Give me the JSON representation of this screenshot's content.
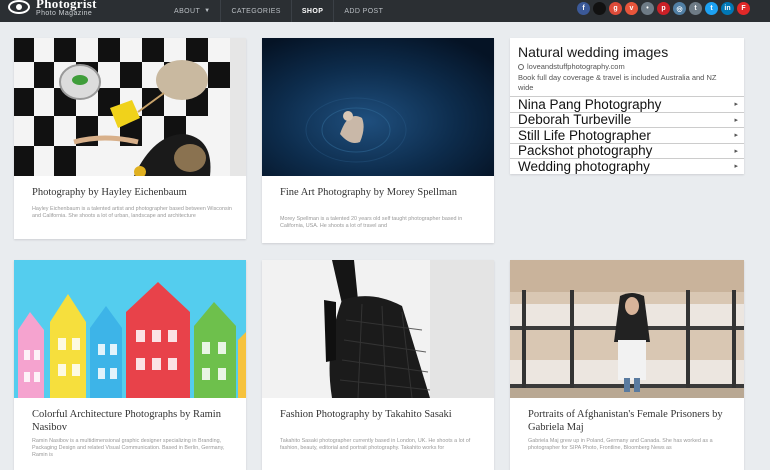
{
  "brand": {
    "title": "Photogrist",
    "subtitle": "Photo Magazine"
  },
  "nav": [
    {
      "label": "ABOUT",
      "dropdown": true
    },
    {
      "label": "CATEGORIES",
      "dropdown": false
    },
    {
      "label": "SHOP",
      "dropdown": false,
      "active": true
    },
    {
      "label": "ADD POST",
      "dropdown": false
    }
  ],
  "social": [
    {
      "icon": "facebook-icon",
      "glyph": "f",
      "color": "#3b5998"
    },
    {
      "icon": "circle-icon",
      "glyph": "",
      "color": "#111111"
    },
    {
      "icon": "google-plus-icon",
      "glyph": "g",
      "color": "#dd4b39"
    },
    {
      "icon": "vine-icon",
      "glyph": "v",
      "color": "#e8553b"
    },
    {
      "icon": "flickr-icon",
      "glyph": "•",
      "color": "#6e7b86"
    },
    {
      "icon": "pinterest-icon",
      "glyph": "p",
      "color": "#cb2027"
    },
    {
      "icon": "instagram-icon",
      "glyph": "◎",
      "color": "#517fa4"
    },
    {
      "icon": "tumblr-icon",
      "glyph": "t",
      "color": "#6e7b86"
    },
    {
      "icon": "twitter-icon",
      "glyph": "t",
      "color": "#1da1f2"
    },
    {
      "icon": "linkedin-icon",
      "glyph": "in",
      "color": "#0077b5"
    },
    {
      "icon": "flipboard-icon",
      "glyph": "F",
      "color": "#e12828"
    }
  ],
  "cards": [
    {
      "title": "Photography by Hayley Eichenbaum",
      "desc": "Hayley Eichenbaum is a talented artist and photographer based between Wisconsin and California. She shoots a lot of urban, landscape and architecture"
    },
    {
      "title": "Fine Art Photography by Morey Spellman",
      "desc": "Morey Spellman is a talented 20 years old self taught photographer based in California, USA. He shoots a lot of travel and"
    },
    {
      "title": "Colorful Architecture Photographs by Ramin Nasibov",
      "desc": "Ramin Nasibov is a multidimensional graphic designer specializing in Branding, Packaging Design and related Visual Communication. Based in Berlin, Germany, Ramin is"
    },
    {
      "title": "Fashion Photography by Takahito Sasaki",
      "desc": "Takahito Sasaki photographer currently based in London, UK. He shoots a lot of fashion, beauty, editorial and portrait photography. Takahito works for"
    },
    {
      "title": "Portraits of Afghanistan's Female Prisoners by Gabriela Maj",
      "desc": "Gabriela Maj grew up in Poland, Germany and Canada. She has worked as a photographer for SIPA Photo, Frontline, Bloomberg News as"
    }
  ],
  "ad": {
    "title": "Natural wedding images",
    "url": "loveandstuffphotography.com",
    "text": "Book full day coverage & travel is included Australia and NZ wide",
    "links": [
      "Nina Pang Photography",
      "Deborah Turbeville",
      "Still Life Photographer",
      "Packshot photography",
      "Wedding photography"
    ]
  }
}
